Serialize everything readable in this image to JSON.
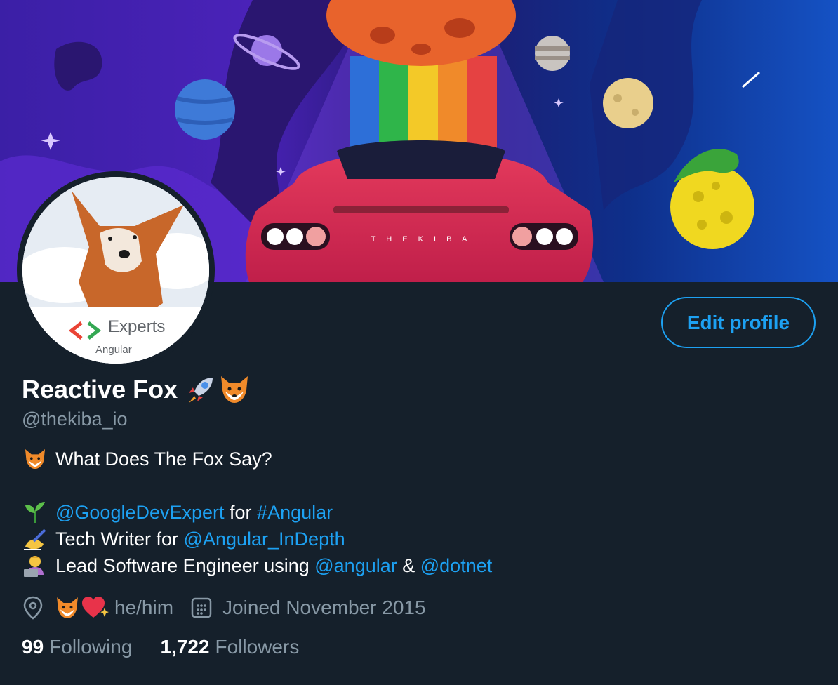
{
  "profile": {
    "display_name": "Reactive Fox",
    "name_emojis": [
      "rocket-emoji",
      "fox-emoji"
    ],
    "handle": "@thekiba_io",
    "edit_button_label": "Edit profile"
  },
  "avatar": {
    "badge_title": "Experts",
    "badge_subtitle": "Angular"
  },
  "banner": {
    "plate_text": "T H E K I B A"
  },
  "bio": {
    "line1": {
      "icon": "fox-emoji",
      "text": "What Does The Fox Say?"
    },
    "line2": {
      "icon": "seedling-emoji",
      "mention": "@GoogleDevExpert",
      "middle": " for ",
      "hashtag": "#Angular"
    },
    "line3": {
      "icon": "writing-hand-emoji",
      "text": "Tech Writer for ",
      "mention": "@Angular_InDepth"
    },
    "line4": {
      "icon": "technologist-emoji",
      "text": "Lead Software Engineer using ",
      "mention1": "@angular",
      "amp": " & ",
      "mention2": "@dotnet"
    }
  },
  "meta": {
    "location_icon": "location-pin-icon",
    "location_emojis": [
      "fox-emoji",
      "sparkling-heart-emoji"
    ],
    "location_text": "he/him",
    "joined_icon": "calendar-icon",
    "joined_text": "Joined November 2015"
  },
  "stats": {
    "following_count": "99",
    "following_label": "Following",
    "followers_count": "1,722",
    "followers_label": "Followers"
  },
  "colors": {
    "background": "#15202b",
    "accent": "#1da1f2",
    "secondary_text": "#8899a6"
  }
}
